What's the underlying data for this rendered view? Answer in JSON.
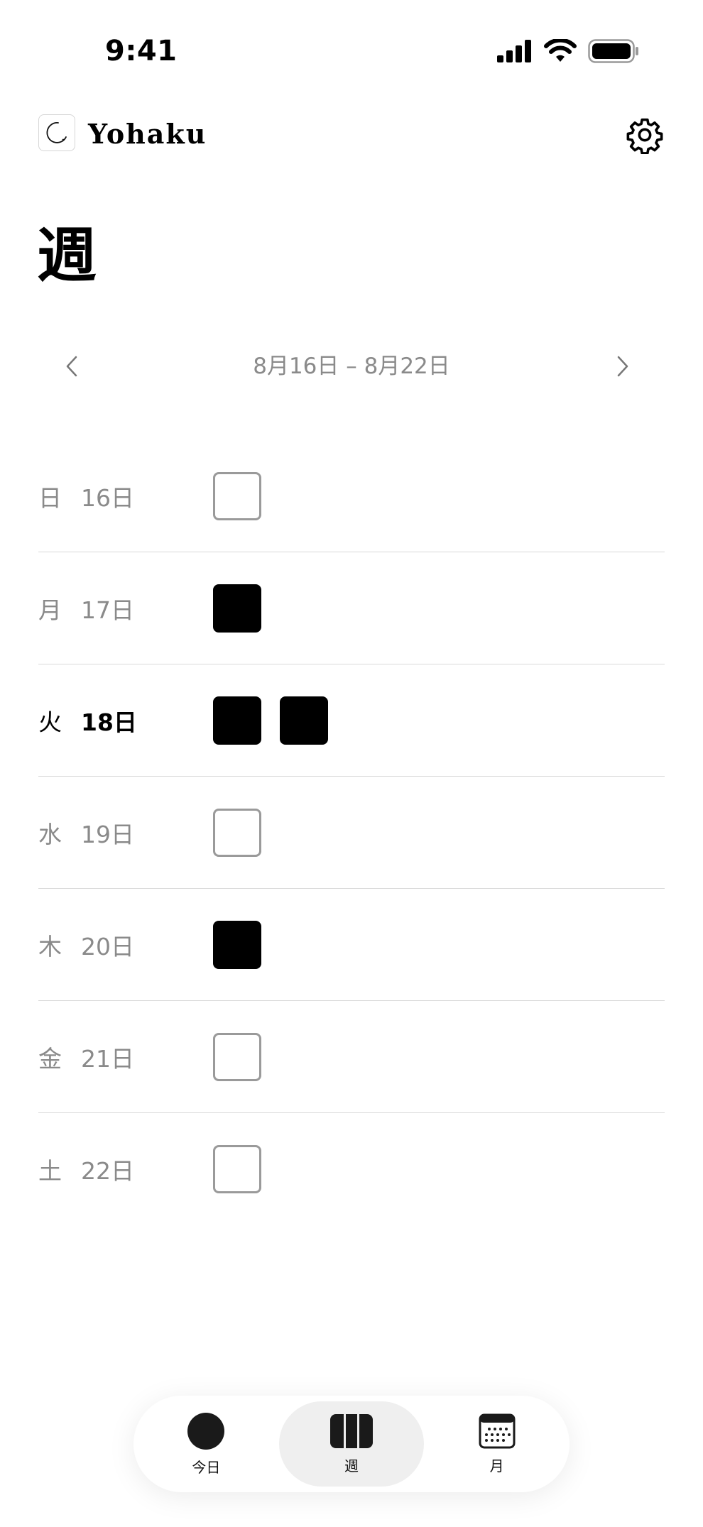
{
  "status_bar": {
    "time": "9:41"
  },
  "header": {
    "app_name": "Yohaku"
  },
  "page": {
    "title": "週"
  },
  "week_nav": {
    "range": "8月16日 – 8月22日"
  },
  "days": [
    {
      "weekday": "日",
      "date": "16日",
      "entries": [
        false
      ],
      "today": false
    },
    {
      "weekday": "月",
      "date": "17日",
      "entries": [
        true
      ],
      "today": false
    },
    {
      "weekday": "火",
      "date": "18日",
      "entries": [
        true,
        true
      ],
      "today": true
    },
    {
      "weekday": "水",
      "date": "19日",
      "entries": [
        false
      ],
      "today": false
    },
    {
      "weekday": "木",
      "date": "20日",
      "entries": [
        true
      ],
      "today": false
    },
    {
      "weekday": "金",
      "date": "21日",
      "entries": [
        false
      ],
      "today": false
    },
    {
      "weekday": "土",
      "date": "22日",
      "entries": [
        false
      ],
      "today": false
    }
  ],
  "tabbar": {
    "tabs": [
      {
        "id": "today",
        "label": "今日",
        "icon": "circle-icon",
        "active": false
      },
      {
        "id": "week",
        "label": "週",
        "icon": "week-columns-icon",
        "active": true
      },
      {
        "id": "month",
        "label": "月",
        "icon": "calendar-icon",
        "active": false
      }
    ]
  },
  "colors": {
    "accent": "#000000",
    "muted_text": "#8a8a8a",
    "divider": "#d9d9d9",
    "tab_active_bg": "#efefef"
  }
}
